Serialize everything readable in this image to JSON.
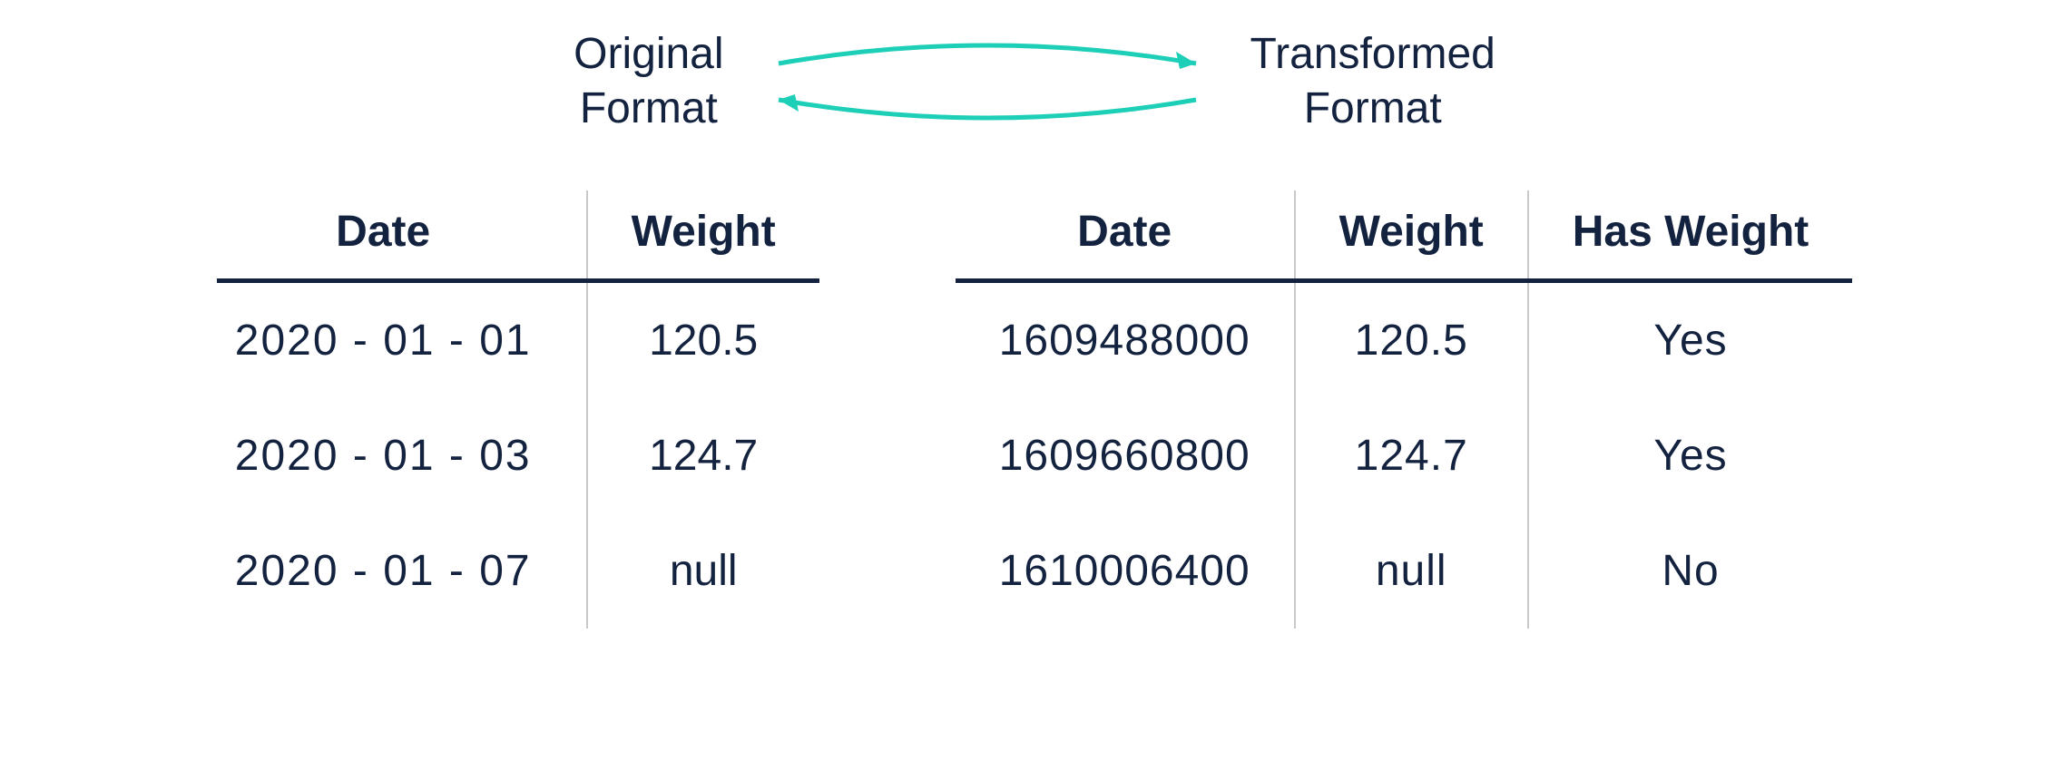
{
  "labels": {
    "original_line1": "Original",
    "original_line2": "Format",
    "transformed_line1": "Transformed",
    "transformed_line2": "Format"
  },
  "colors": {
    "text": "#13223f",
    "arrow": "#1ecfb8"
  },
  "original_table": {
    "headers": [
      "Date",
      "Weight"
    ],
    "rows": [
      {
        "date": "2020 - 01 - 01",
        "weight": "120.5"
      },
      {
        "date": "2020 - 01 - 03",
        "weight": "124.7"
      },
      {
        "date": "2020 - 01 - 07",
        "weight": "null"
      }
    ]
  },
  "transformed_table": {
    "headers": [
      "Date",
      "Weight",
      "Has Weight"
    ],
    "rows": [
      {
        "date": "1609488000",
        "weight": "120.5",
        "has_weight": "Yes"
      },
      {
        "date": "1609660800",
        "weight": "124.7",
        "has_weight": "Yes"
      },
      {
        "date": "1610006400",
        "weight": "null",
        "has_weight": "No"
      }
    ]
  }
}
